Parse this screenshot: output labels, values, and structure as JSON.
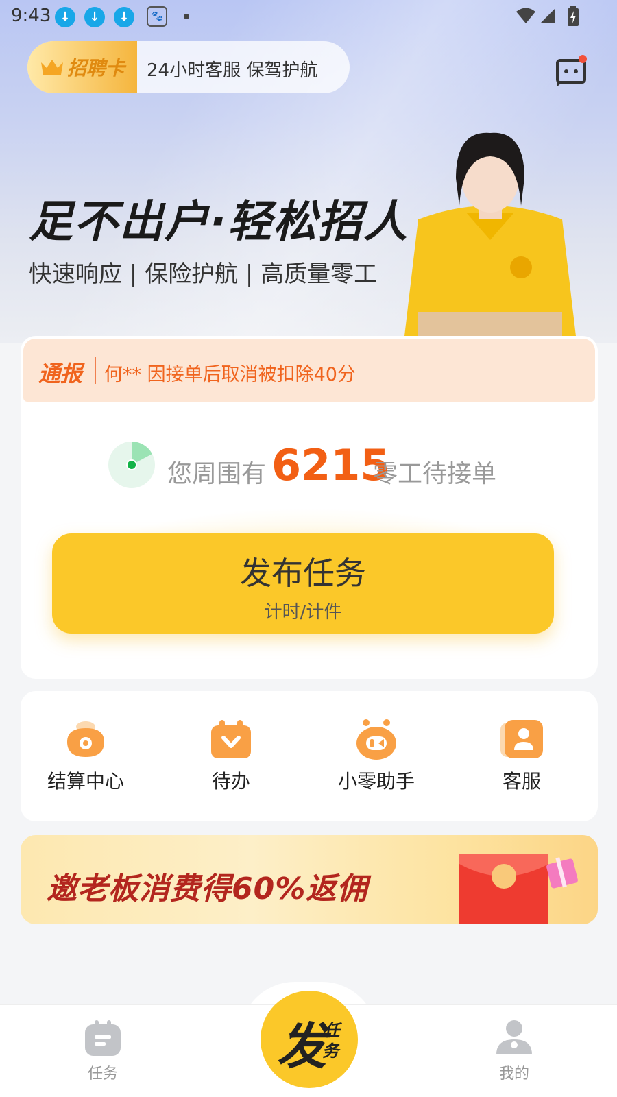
{
  "status_bar": {
    "time": "9:43",
    "icons": [
      "download-icon",
      "download-icon",
      "download-icon",
      "baidu-icon",
      "dot-icon",
      "wifi-icon",
      "signal-icon",
      "battery-charging-icon"
    ]
  },
  "header": {
    "recruit_badge": "招聘卡",
    "recruit_text": "24小时客服 保驾护航",
    "message_icon": "message-icon"
  },
  "hero": {
    "slogan_main": "足不出户·轻松招人",
    "slogan_sub": "快速响应 | 保险护航 | 高质量零工"
  },
  "notice": {
    "tag": "通报",
    "text": "何** 因接单后取消被扣除40分"
  },
  "nearby": {
    "prefix": "您周围有",
    "count": "6215",
    "suffix": "零工待接单"
  },
  "publish": {
    "title": "发布任务",
    "subtitle": "计时/计件"
  },
  "tools": [
    {
      "label": "结算中心",
      "icon": "wallet-icon"
    },
    {
      "label": "待办",
      "icon": "todo-icon"
    },
    {
      "label": "小零助手",
      "icon": "robot-icon"
    },
    {
      "label": "客服",
      "icon": "customer-service-icon"
    }
  ],
  "promo": {
    "text": "邀老板消费得60%返佣"
  },
  "bottom_nav": {
    "tasks_label": "任务",
    "fab_main": "发",
    "fab_sub1": "任",
    "fab_sub2": "务",
    "mine_label": "我的"
  },
  "colors": {
    "accent": "#fbc829",
    "highlight": "#f25f14",
    "notice_bg": "#fde6d5",
    "tool_icon": "#f9a045"
  }
}
